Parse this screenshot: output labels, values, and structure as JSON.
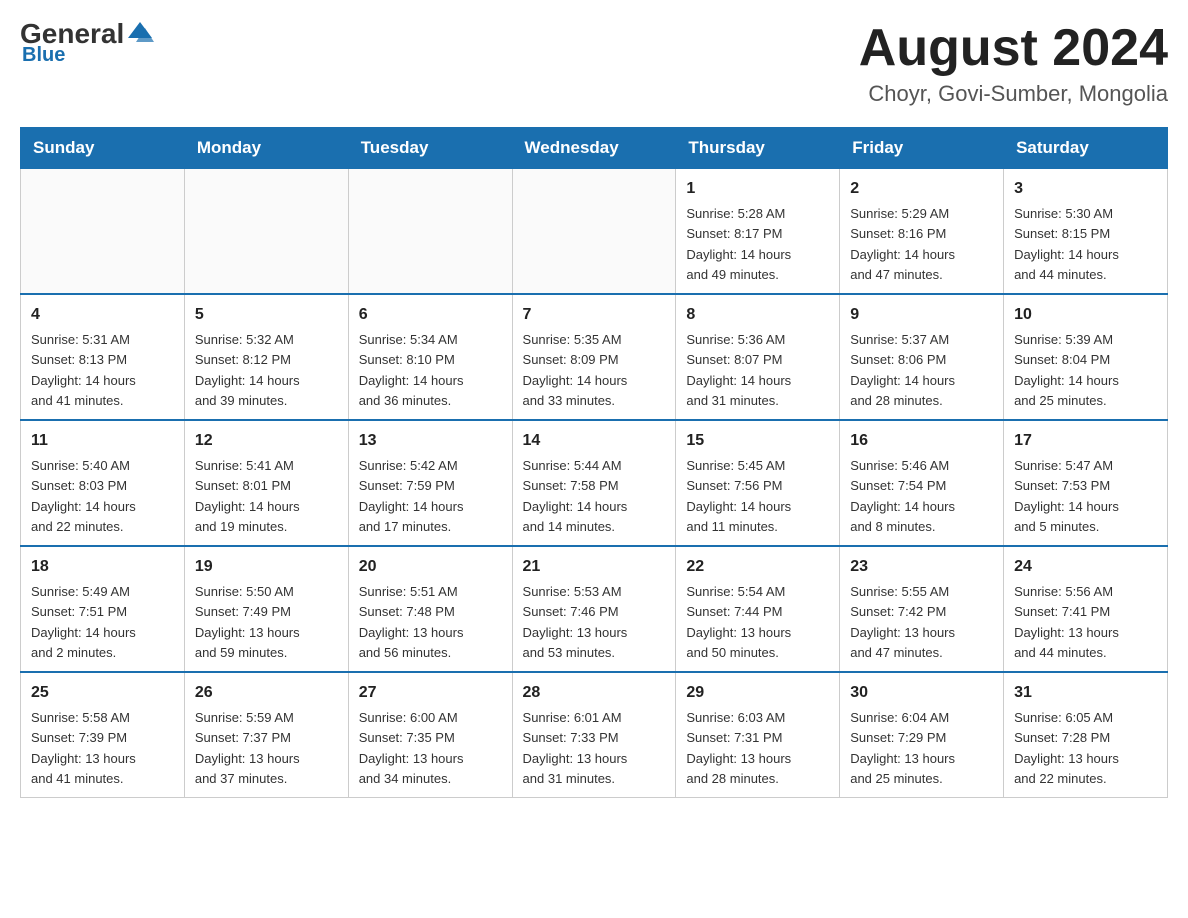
{
  "header": {
    "logo_general": "General",
    "logo_blue": "Blue",
    "month_title": "August 2024",
    "subtitle": "Choyr, Govi-Sumber, Mongolia"
  },
  "weekdays": [
    "Sunday",
    "Monday",
    "Tuesday",
    "Wednesday",
    "Thursday",
    "Friday",
    "Saturday"
  ],
  "weeks": [
    [
      {
        "day": "",
        "info": ""
      },
      {
        "day": "",
        "info": ""
      },
      {
        "day": "",
        "info": ""
      },
      {
        "day": "",
        "info": ""
      },
      {
        "day": "1",
        "info": "Sunrise: 5:28 AM\nSunset: 8:17 PM\nDaylight: 14 hours\nand 49 minutes."
      },
      {
        "day": "2",
        "info": "Sunrise: 5:29 AM\nSunset: 8:16 PM\nDaylight: 14 hours\nand 47 minutes."
      },
      {
        "day": "3",
        "info": "Sunrise: 5:30 AM\nSunset: 8:15 PM\nDaylight: 14 hours\nand 44 minutes."
      }
    ],
    [
      {
        "day": "4",
        "info": "Sunrise: 5:31 AM\nSunset: 8:13 PM\nDaylight: 14 hours\nand 41 minutes."
      },
      {
        "day": "5",
        "info": "Sunrise: 5:32 AM\nSunset: 8:12 PM\nDaylight: 14 hours\nand 39 minutes."
      },
      {
        "day": "6",
        "info": "Sunrise: 5:34 AM\nSunset: 8:10 PM\nDaylight: 14 hours\nand 36 minutes."
      },
      {
        "day": "7",
        "info": "Sunrise: 5:35 AM\nSunset: 8:09 PM\nDaylight: 14 hours\nand 33 minutes."
      },
      {
        "day": "8",
        "info": "Sunrise: 5:36 AM\nSunset: 8:07 PM\nDaylight: 14 hours\nand 31 minutes."
      },
      {
        "day": "9",
        "info": "Sunrise: 5:37 AM\nSunset: 8:06 PM\nDaylight: 14 hours\nand 28 minutes."
      },
      {
        "day": "10",
        "info": "Sunrise: 5:39 AM\nSunset: 8:04 PM\nDaylight: 14 hours\nand 25 minutes."
      }
    ],
    [
      {
        "day": "11",
        "info": "Sunrise: 5:40 AM\nSunset: 8:03 PM\nDaylight: 14 hours\nand 22 minutes."
      },
      {
        "day": "12",
        "info": "Sunrise: 5:41 AM\nSunset: 8:01 PM\nDaylight: 14 hours\nand 19 minutes."
      },
      {
        "day": "13",
        "info": "Sunrise: 5:42 AM\nSunset: 7:59 PM\nDaylight: 14 hours\nand 17 minutes."
      },
      {
        "day": "14",
        "info": "Sunrise: 5:44 AM\nSunset: 7:58 PM\nDaylight: 14 hours\nand 14 minutes."
      },
      {
        "day": "15",
        "info": "Sunrise: 5:45 AM\nSunset: 7:56 PM\nDaylight: 14 hours\nand 11 minutes."
      },
      {
        "day": "16",
        "info": "Sunrise: 5:46 AM\nSunset: 7:54 PM\nDaylight: 14 hours\nand 8 minutes."
      },
      {
        "day": "17",
        "info": "Sunrise: 5:47 AM\nSunset: 7:53 PM\nDaylight: 14 hours\nand 5 minutes."
      }
    ],
    [
      {
        "day": "18",
        "info": "Sunrise: 5:49 AM\nSunset: 7:51 PM\nDaylight: 14 hours\nand 2 minutes."
      },
      {
        "day": "19",
        "info": "Sunrise: 5:50 AM\nSunset: 7:49 PM\nDaylight: 13 hours\nand 59 minutes."
      },
      {
        "day": "20",
        "info": "Sunrise: 5:51 AM\nSunset: 7:48 PM\nDaylight: 13 hours\nand 56 minutes."
      },
      {
        "day": "21",
        "info": "Sunrise: 5:53 AM\nSunset: 7:46 PM\nDaylight: 13 hours\nand 53 minutes."
      },
      {
        "day": "22",
        "info": "Sunrise: 5:54 AM\nSunset: 7:44 PM\nDaylight: 13 hours\nand 50 minutes."
      },
      {
        "day": "23",
        "info": "Sunrise: 5:55 AM\nSunset: 7:42 PM\nDaylight: 13 hours\nand 47 minutes."
      },
      {
        "day": "24",
        "info": "Sunrise: 5:56 AM\nSunset: 7:41 PM\nDaylight: 13 hours\nand 44 minutes."
      }
    ],
    [
      {
        "day": "25",
        "info": "Sunrise: 5:58 AM\nSunset: 7:39 PM\nDaylight: 13 hours\nand 41 minutes."
      },
      {
        "day": "26",
        "info": "Sunrise: 5:59 AM\nSunset: 7:37 PM\nDaylight: 13 hours\nand 37 minutes."
      },
      {
        "day": "27",
        "info": "Sunrise: 6:00 AM\nSunset: 7:35 PM\nDaylight: 13 hours\nand 34 minutes."
      },
      {
        "day": "28",
        "info": "Sunrise: 6:01 AM\nSunset: 7:33 PM\nDaylight: 13 hours\nand 31 minutes."
      },
      {
        "day": "29",
        "info": "Sunrise: 6:03 AM\nSunset: 7:31 PM\nDaylight: 13 hours\nand 28 minutes."
      },
      {
        "day": "30",
        "info": "Sunrise: 6:04 AM\nSunset: 7:29 PM\nDaylight: 13 hours\nand 25 minutes."
      },
      {
        "day": "31",
        "info": "Sunrise: 6:05 AM\nSunset: 7:28 PM\nDaylight: 13 hours\nand 22 minutes."
      }
    ]
  ]
}
